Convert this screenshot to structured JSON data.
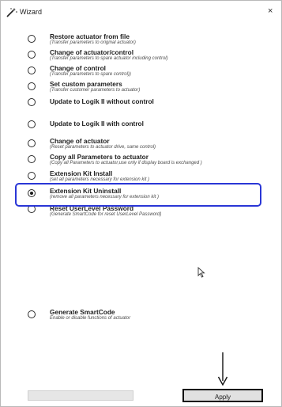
{
  "window": {
    "title": "Wizard",
    "close_label": "×"
  },
  "options": [
    {
      "label": "Restore actuator from file",
      "sub": "(Transfer parameters to original actuator)",
      "selected": false
    },
    {
      "label": "Change of actuator/control",
      "sub": "(Transfer parameters to spare actuator including control)",
      "selected": false
    },
    {
      "label": "Change of control",
      "sub": "(Transfer parameters to spare control))",
      "selected": false
    },
    {
      "label": "Set custom parameters",
      "sub": "(Transfer customer parameters to actuator)",
      "selected": false
    },
    {
      "label": "Update to Logik II without control",
      "sub": "",
      "selected": false
    },
    {
      "label": "Update to Logik II with control",
      "sub": "",
      "selected": false
    },
    {
      "label": "Change of actuator",
      "sub": "(Reset parameters to actuator drive, same control)",
      "selected": false
    },
    {
      "label": "Copy all Parameters to actuator",
      "sub": "(Copy all Parameters to actuator,use only if display board is exchanged )",
      "selected": false
    },
    {
      "label": "Extension Kit Install",
      "sub": "(set all parameters necessary for extension kit )",
      "selected": false
    },
    {
      "label": "Extension Kit Uninstall",
      "sub": "(remove all parameters necessary for extension kit )",
      "selected": true
    },
    {
      "label": "Reset UserLevel Password",
      "sub": "(Generate SmartCode for reset UserLevel Password)",
      "selected": false
    },
    {
      "label": "Generate SmartCode",
      "sub": "Enable or disable functions of actuator",
      "selected": false
    }
  ],
  "footer": {
    "apply_label": "Apply",
    "progress": 0
  },
  "colors": {
    "highlight": "#2a36d6"
  }
}
